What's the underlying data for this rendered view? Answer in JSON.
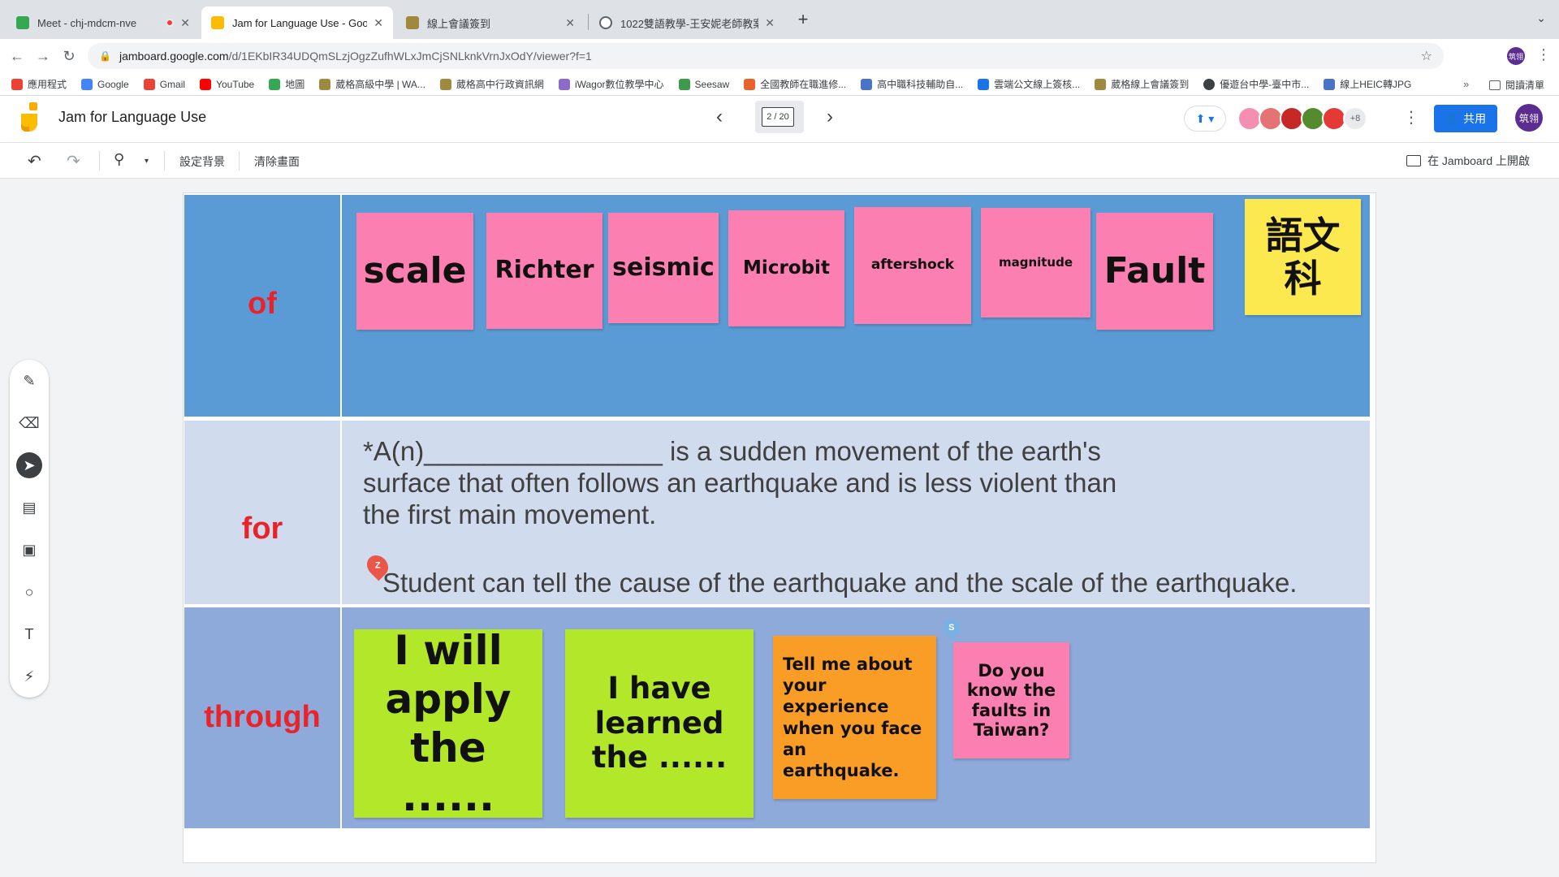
{
  "browser": {
    "tabs": [
      {
        "title": "Meet - chj-mdcm-nve",
        "favicon_color": "#34a853",
        "recording": true
      },
      {
        "title": "Jam for Language Use - Googl",
        "favicon_color": "#fbbc04",
        "active": true
      },
      {
        "title": "線上會議簽到",
        "favicon_color": "#9e8a3e"
      },
      {
        "title": "1022雙語教學-王安妮老師教案.p",
        "favicon_color": "#5f6368"
      }
    ],
    "address": {
      "host": "jamboard.google.com",
      "path": "/d/1EKbIR34UDQmSLzjOgzZufhWLxJmCjSNLknkVrnJxOdY/viewer?f=1"
    },
    "profile_initials": "筑翎",
    "bookmarks": [
      {
        "label": "應用程式",
        "color": "#ea4335"
      },
      {
        "label": "Google",
        "color": "#4285f4"
      },
      {
        "label": "Gmail",
        "color": "#ea4335"
      },
      {
        "label": "YouTube",
        "color": "#ff0000"
      },
      {
        "label": "地圖",
        "color": "#34a853"
      },
      {
        "label": "葳格高級中學 | WA...",
        "color": "#9e8a3e"
      },
      {
        "label": "葳格高中行政資訊網",
        "color": "#9e8a3e"
      },
      {
        "label": "iWagor數位教學中心",
        "color": "#8e6ac8"
      },
      {
        "label": "Seesaw",
        "color": "#3c9a4a"
      },
      {
        "label": "全國教師在職進修...",
        "color": "#e8632b"
      },
      {
        "label": "高中職科技輔助自...",
        "color": "#4a73c6"
      },
      {
        "label": "雲端公文線上簽核...",
        "color": "#1a73e8"
      },
      {
        "label": "葳格線上會議簽到",
        "color": "#9e8a3e"
      },
      {
        "label": "優遊台中學-臺中市...",
        "color": "#3c4043"
      },
      {
        "label": "線上HEIC轉JPG",
        "color": "#4a73c6"
      }
    ],
    "bookmarks_more": "»",
    "reading_list": "閱讀清單"
  },
  "jamboard": {
    "title": "Jam for Language Use",
    "frame_counter": "2 / 20",
    "collaborators_more": "+8",
    "share_label": "共用",
    "profile_initials": "筑翎",
    "toolbar": {
      "set_background": "設定背景",
      "clear_frame": "清除畫面",
      "open_in_jamboard": "在 Jamboard 上開啟"
    }
  },
  "board": {
    "rows": [
      {
        "label": "of"
      },
      {
        "label": "for"
      },
      {
        "label": "through"
      }
    ],
    "row1_notes": [
      {
        "text": "scale"
      },
      {
        "text": "Richter"
      },
      {
        "text": "seismic"
      },
      {
        "text": "Microbit"
      },
      {
        "text": "aftershock"
      },
      {
        "text": "magnitude"
      },
      {
        "text": "Fault"
      },
      {
        "text": "語文科"
      }
    ],
    "question_lines": [
      "*A(n)________________ is a sudden movement of the earth's",
      "surface that often follows an earthquake and is less violent than",
      "the first main movement."
    ],
    "objective": "Student can tell the cause of the earthquake and the scale of the earthquake.",
    "row3_notes": [
      {
        "text": "I  will apply the ......"
      },
      {
        "text": "I  have learned the ......"
      },
      {
        "text": "Tell me about your experience when you face an earthquake."
      },
      {
        "text": "Do you know the faults in Taiwan?"
      }
    ],
    "pin_a_initial": "Z",
    "pin_b_initial": "S"
  }
}
